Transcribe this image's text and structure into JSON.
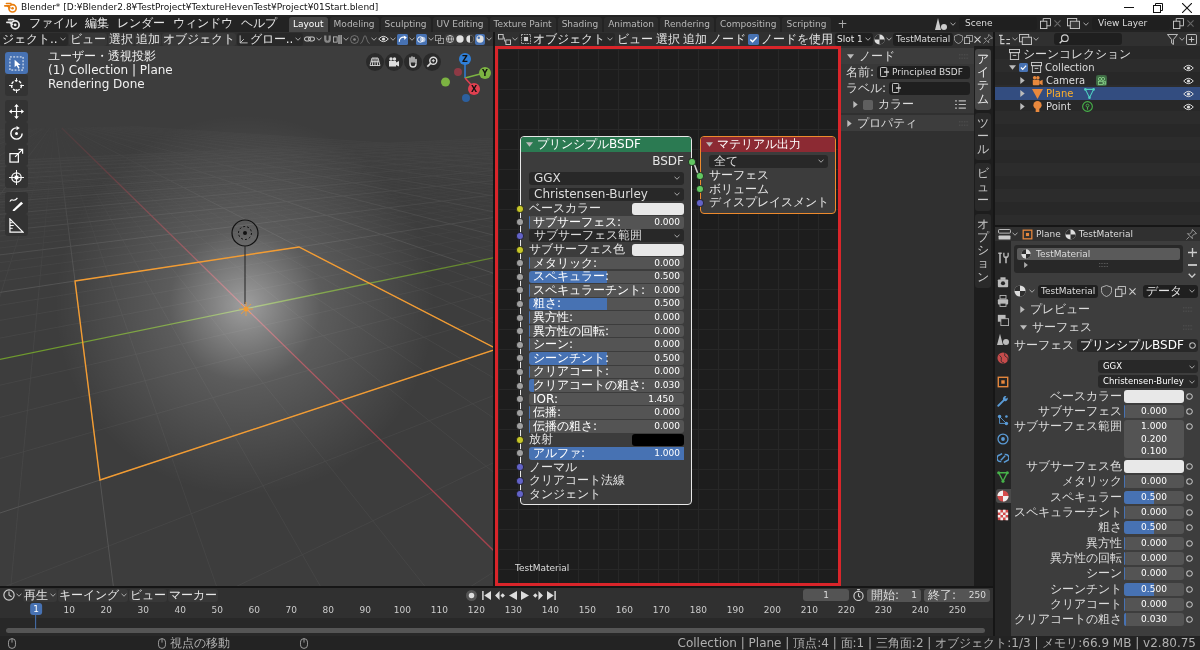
{
  "window": {
    "title": "Blender* [D:¥Blender2.8¥TestProject¥TextureHevenTest¥Project¥01Start.blend]"
  },
  "topbar": {
    "menus": [
      "ファイル",
      "編集",
      "レンダー",
      "ウィンドウ",
      "ヘルプ"
    ],
    "workspaces": [
      {
        "label": "Layout",
        "selected": true
      },
      {
        "label": "Modeling",
        "selected": false
      },
      {
        "label": "Sculpting",
        "selected": false
      },
      {
        "label": "UV Editing",
        "selected": false
      },
      {
        "label": "Texture Paint",
        "selected": false
      },
      {
        "label": "Shading",
        "selected": false
      },
      {
        "label": "Animation",
        "selected": false
      },
      {
        "label": "Rendering",
        "selected": false
      },
      {
        "label": "Compositing",
        "selected": false
      },
      {
        "label": "Scripting",
        "selected": false
      }
    ],
    "add_workspace": "+",
    "scene": "Scene",
    "view_layer": "View Layer"
  },
  "viewport": {
    "mode": "ジェクト..",
    "menus": [
      "ビュー",
      "選択",
      "追加",
      "オブジェクト"
    ],
    "orientation": "グロー..",
    "gizmos": true,
    "overlays": true,
    "shading": [
      {
        "kind": "wireframe",
        "selected": false
      },
      {
        "kind": "solid",
        "selected": false
      },
      {
        "kind": "material",
        "selected": false
      },
      {
        "kind": "rendered",
        "selected": true
      }
    ],
    "tools": [
      {
        "kind": "select",
        "selected": true
      },
      {
        "kind": "cursor",
        "selected": false
      },
      {
        "kind": "move",
        "selected": false
      },
      {
        "kind": "rotate",
        "selected": false
      },
      {
        "kind": "scale",
        "selected": false
      },
      {
        "kind": "transform",
        "selected": false
      },
      {
        "kind": "annotate",
        "selected": false
      },
      {
        "kind": "measure",
        "selected": false
      }
    ],
    "info": [
      "ユーザー・透視投影",
      "(1) Collection | Plane",
      "Rendering Done"
    ],
    "axes": [
      "Z",
      "Y",
      "X"
    ]
  },
  "node_editor": {
    "highlighted": true,
    "mode": "オブジェクト",
    "menus": [
      "ビュー",
      "選択",
      "追加",
      "ノード"
    ],
    "use_nodes": {
      "label": "ノードを使用",
      "checked": true
    },
    "slot": "Slot 1",
    "material": "TestMaterial",
    "nodes": [
      {
        "title": "プリンシプルBSDF",
        "color": "#2b7a52",
        "active": true,
        "selected": true,
        "expanded": true,
        "outputs": [
          {
            "label": "BSDF",
            "color": "#63c763",
            "linked": true
          }
        ],
        "options": [
          "GGX",
          "Christensen-Burley"
        ],
        "inputs": [
          {
            "kind": "color",
            "label": "ベースカラー",
            "swatch": {
              "color": "#e8e8e8"
            },
            "color": "#c7c729"
          },
          {
            "kind": "slider",
            "label": "サブサーフェス:",
            "value": "0.000",
            "level": 0,
            "color": "#a1a1a1"
          },
          {
            "kind": "dropdown",
            "label": "サブサーフェス範囲",
            "color": "#6363c7"
          },
          {
            "kind": "color",
            "label": "サブサーフェス色",
            "swatch": {
              "color": "#e8e8e8"
            },
            "color": "#c7c729"
          },
          {
            "kind": "slider",
            "label": "メタリック:",
            "value": "0.000",
            "level": 0,
            "color": "#a1a1a1"
          },
          {
            "kind": "slider",
            "label": "スペキュラー:",
            "value": "0.500",
            "level": 0.5,
            "color": "#a1a1a1"
          },
          {
            "kind": "slider",
            "label": "スペキュラーチント:",
            "value": "0.000",
            "level": 0,
            "color": "#a1a1a1"
          },
          {
            "kind": "slider",
            "label": "粗さ:",
            "value": "0.500",
            "level": 0.5,
            "color": "#a1a1a1"
          },
          {
            "kind": "slider",
            "label": "異方性:",
            "value": "0.000",
            "level": 0,
            "color": "#a1a1a1"
          },
          {
            "kind": "slider",
            "label": "異方性の回転:",
            "value": "0.000",
            "level": 0,
            "color": "#a1a1a1"
          },
          {
            "kind": "slider",
            "label": "シーン:",
            "value": "0.000",
            "level": 0,
            "color": "#a1a1a1"
          },
          {
            "kind": "slider",
            "label": "シーンチント:",
            "value": "0.500",
            "level": 0.5,
            "color": "#a1a1a1"
          },
          {
            "kind": "slider",
            "label": "クリアコート:",
            "value": "0.000",
            "level": 0,
            "color": "#a1a1a1"
          },
          {
            "kind": "slider",
            "label": "クリアコートの粗さ:",
            "value": "0.030",
            "level": 0.03,
            "color": "#a1a1a1"
          },
          {
            "kind": "number",
            "label": "IOR:",
            "value": "1.450",
            "color": "#a1a1a1"
          },
          {
            "kind": "slider",
            "label": "伝播:",
            "value": "0.000",
            "level": 0,
            "color": "#a1a1a1"
          },
          {
            "kind": "slider",
            "label": "伝播の粗さ:",
            "value": "0.000",
            "level": 0,
            "color": "#a1a1a1"
          },
          {
            "kind": "color",
            "label": "放射",
            "swatch": {
              "color": "#000000"
            },
            "color": "#c7c729"
          },
          {
            "kind": "slider",
            "label": "アルファ:",
            "value": "1.000",
            "level": 1,
            "color": "#a1a1a1"
          },
          {
            "kind": "socket",
            "label": "ノーマル",
            "color": "#6363c7"
          },
          {
            "kind": "socket",
            "label": "クリアコート法線",
            "color": "#6363c7"
          },
          {
            "kind": "socket",
            "label": "タンジェント",
            "color": "#6363c7"
          }
        ]
      },
      {
        "title": "マテリアル出力",
        "color": "#8c2a33",
        "active": false,
        "selected": true,
        "expanded": true,
        "options": [
          "全て"
        ],
        "inputs": [
          {
            "kind": "socket",
            "label": "サーフェス",
            "color": "#63c763",
            "linked": true
          },
          {
            "kind": "socket",
            "label": "ボリューム",
            "color": "#63c763",
            "linked": false
          },
          {
            "kind": "socket",
            "label": "ディスプレイスメント",
            "color": "#6363c7",
            "linked": false
          }
        ]
      }
    ],
    "frame_label": "TestMaterial",
    "sidebar": {
      "tabs": [
        {
          "label": "アイテム",
          "selected": true
        },
        {
          "label": "ツール",
          "selected": false
        },
        {
          "label": "ビュー",
          "selected": false
        },
        {
          "label": "オプション",
          "selected": false
        }
      ],
      "panels": [
        {
          "title": "ノード",
          "expanded": true,
          "fields": [
            {
              "label": "名前:",
              "value": "Principled BSDF"
            },
            {
              "label": "ラベル:"
            }
          ],
          "subpanels": [
            {
              "title": "カラー",
              "expanded": false,
              "checked": false
            }
          ]
        },
        {
          "title": "プロパティ",
          "expanded": false
        }
      ]
    }
  },
  "outliner": {
    "root": "シーンコレクション",
    "items": [
      {
        "label": "Collection",
        "kind": "collection",
        "checked": true,
        "expanded": true,
        "selected": false,
        "visible": true,
        "children": [
          {
            "label": "Camera",
            "kind": "camera",
            "expanded": false,
            "selected": false,
            "visible": true
          },
          {
            "label": "Plane",
            "kind": "mesh",
            "expanded": false,
            "selected": true,
            "visible": true
          },
          {
            "label": "Point",
            "kind": "light",
            "expanded": false,
            "selected": false,
            "visible": true
          }
        ]
      }
    ]
  },
  "properties": {
    "object": "Plane",
    "material": "TestMaterial",
    "tabs": [
      {
        "kind": "tool",
        "selected": false
      },
      {
        "kind": "render",
        "selected": false
      },
      {
        "kind": "output",
        "selected": false
      },
      {
        "kind": "view_layer",
        "selected": false
      },
      {
        "kind": "scene",
        "selected": false
      },
      {
        "kind": "world",
        "selected": false
      },
      {
        "kind": "object",
        "selected": false
      },
      {
        "kind": "modifiers",
        "selected": false
      },
      {
        "kind": "particles",
        "selected": false
      },
      {
        "kind": "physics",
        "selected": false
      },
      {
        "kind": "constraints",
        "selected": false
      },
      {
        "kind": "data",
        "selected": false
      },
      {
        "kind": "material",
        "selected": true
      },
      {
        "kind": "texture",
        "selected": false
      }
    ],
    "slots": [
      {
        "label": "TestMaterial",
        "selected": true
      }
    ],
    "material_field": "TestMaterial",
    "link": "データ",
    "panels": [
      {
        "title": "プレビュー",
        "expanded": false
      },
      {
        "title": "サーフェス",
        "expanded": true,
        "rows": [
          {
            "kind": "shader",
            "label": "サーフェス",
            "value": "プリンシプルBSDF"
          },
          {
            "kind": "dropdown",
            "value": "GGX"
          },
          {
            "kind": "dropdown",
            "value": "Christensen-Burley"
          },
          {
            "kind": "color",
            "label": "ベースカラー",
            "swatch": {
              "color": "#e8e8e8"
            }
          },
          {
            "kind": "slider",
            "label": "サブサーフェス",
            "value": "0.000",
            "level": 0
          },
          {
            "kind": "vector",
            "label": "サブサーフェス範囲",
            "values": [
              "1.000",
              "0.200",
              "0.100"
            ]
          },
          {
            "kind": "color",
            "label": "サブサーフェス色",
            "swatch": {
              "color": "#e8e8e8"
            }
          },
          {
            "kind": "slider",
            "label": "メタリック",
            "value": "0.000",
            "level": 0
          },
          {
            "kind": "slider",
            "label": "スペキュラー",
            "value": "0.500",
            "level": 0.5
          },
          {
            "kind": "slider",
            "label": "スペキュラーチント",
            "value": "0.000",
            "level": 0
          },
          {
            "kind": "slider",
            "label": "粗さ",
            "value": "0.500",
            "level": 0.5
          },
          {
            "kind": "slider",
            "label": "異方性",
            "value": "0.000",
            "level": 0
          },
          {
            "kind": "slider",
            "label": "異方性の回転",
            "value": "0.000",
            "level": 0
          },
          {
            "kind": "slider",
            "label": "シーン",
            "value": "0.000",
            "level": 0
          },
          {
            "kind": "slider",
            "label": "シーンチント",
            "value": "0.500",
            "level": 0.5
          },
          {
            "kind": "slider",
            "label": "クリアコート",
            "value": "0.000",
            "level": 0
          },
          {
            "kind": "slider",
            "label": "クリアコートの粗さ",
            "value": "0.030",
            "level": 0.03
          }
        ]
      }
    ]
  },
  "timeline": {
    "menus": [
      {
        "kind": "dropdown",
        "label": "再生"
      },
      {
        "kind": "dropdown",
        "label": "キーイング"
      },
      {
        "kind": "menu",
        "label": "ビュー"
      },
      {
        "kind": "menu",
        "label": "マーカー"
      }
    ],
    "current_frame": "1",
    "start": {
      "label": "開始:",
      "value": "1"
    },
    "end": {
      "label": "終了:",
      "value": "250"
    },
    "ruler": [
      {
        "label": "1",
        "current": true
      },
      {
        "label": "10",
        "current": false
      },
      {
        "label": "20",
        "current": false
      },
      {
        "label": "30",
        "current": false
      },
      {
        "label": "40",
        "current": false
      },
      {
        "label": "50",
        "current": false
      },
      {
        "label": "60",
        "current": false
      },
      {
        "label": "70",
        "current": false
      },
      {
        "label": "80",
        "current": false
      },
      {
        "label": "90",
        "current": false
      },
      {
        "label": "100",
        "current": false
      },
      {
        "label": "110",
        "current": false
      },
      {
        "label": "120",
        "current": false
      },
      {
        "label": "130",
        "current": false
      },
      {
        "label": "140",
        "current": false
      },
      {
        "label": "150",
        "current": false
      },
      {
        "label": "160",
        "current": false
      },
      {
        "label": "170",
        "current": false
      },
      {
        "label": "180",
        "current": false
      },
      {
        "label": "190",
        "current": false
      },
      {
        "label": "200",
        "current": false
      },
      {
        "label": "210",
        "current": false
      },
      {
        "label": "220",
        "current": false
      },
      {
        "label": "230",
        "current": false
      },
      {
        "label": "240",
        "current": false
      },
      {
        "label": "250",
        "current": false
      }
    ]
  },
  "status_bar": {
    "hint": "視点の移動",
    "stats": "Collection | Plane | 頂点:4 | 面:1 | 三角面:2 | オブジェクト:1/3 | メモリ:66.9 MB | v2.80.75"
  }
}
